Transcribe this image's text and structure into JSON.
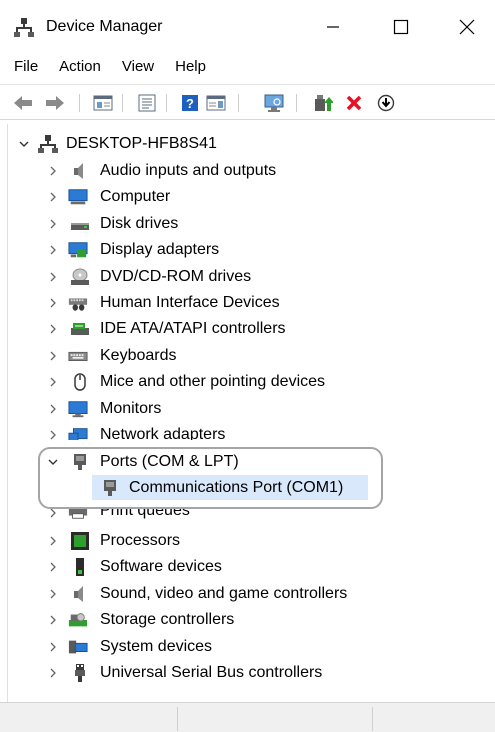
{
  "window": {
    "title": "Device Manager",
    "controls": {
      "minimize": "minimize",
      "maximize": "maximize",
      "close": "close"
    }
  },
  "menu": {
    "items": [
      "File",
      "Action",
      "View",
      "Help"
    ]
  },
  "toolbar": {
    "icons": [
      "back-icon",
      "forward-icon",
      "show-hide-console-tree-icon",
      "properties-icon",
      "help-icon",
      "action-pane-icon",
      "scan-hardware-icon",
      "update-driver-icon",
      "uninstall-icon",
      "disable-device-icon"
    ]
  },
  "tree": {
    "root": "DESKTOP-HFB8S41",
    "categories": [
      {
        "label": "Audio inputs and outputs",
        "icon": "speaker-icon"
      },
      {
        "label": "Computer",
        "icon": "computer-icon"
      },
      {
        "label": "Disk drives",
        "icon": "disk-drive-icon"
      },
      {
        "label": "Display adapters",
        "icon": "display-adapter-icon"
      },
      {
        "label": "DVD/CD-ROM drives",
        "icon": "dvd-drive-icon"
      },
      {
        "label": "Human Interface Devices",
        "icon": "hid-icon"
      },
      {
        "label": "IDE ATA/ATAPI controllers",
        "icon": "ide-controller-icon"
      },
      {
        "label": "Keyboards",
        "icon": "keyboard-icon"
      },
      {
        "label": "Mice and other pointing devices",
        "icon": "mouse-icon"
      },
      {
        "label": "Monitors",
        "icon": "monitor-icon"
      },
      {
        "label": "Network adapters",
        "icon": "network-adapter-icon"
      },
      {
        "label": "Ports (COM & LPT)",
        "icon": "port-icon",
        "expanded": true
      },
      {
        "label": "Print queues",
        "icon": "printer-icon"
      },
      {
        "label": "Processors",
        "icon": "processor-icon"
      },
      {
        "label": "Software devices",
        "icon": "software-device-icon"
      },
      {
        "label": "Sound, video and game controllers",
        "icon": "sound-icon"
      },
      {
        "label": "Storage controllers",
        "icon": "storage-controller-icon"
      },
      {
        "label": "System devices",
        "icon": "system-device-icon"
      },
      {
        "label": "Universal Serial Bus controllers",
        "icon": "usb-icon"
      }
    ],
    "port_child": "Communications Port (COM1)"
  },
  "colors": {
    "selection": "#d9e8fb",
    "highlight_border": "#a5a5a5",
    "uninstall_red": "#e81123",
    "help_blue": "#1f5fbf"
  }
}
